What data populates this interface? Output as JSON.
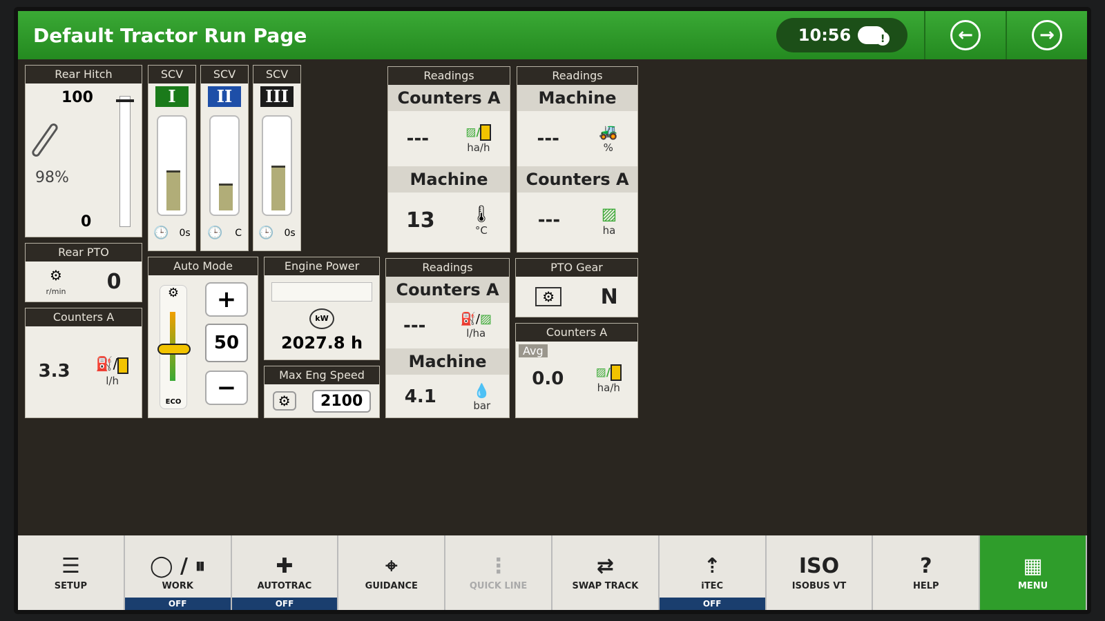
{
  "header": {
    "title": "Default Tractor Run Page",
    "time": "10:56",
    "back_icon": "arrow-left-icon",
    "forward_icon": "arrow-right-icon"
  },
  "rear_hitch": {
    "title": "Rear Hitch",
    "max": "100",
    "min": "0",
    "percent": "98%",
    "level_fraction": 0.98
  },
  "scv": [
    {
      "title": "SCV",
      "numeral": "I",
      "color": "#1a7a1a",
      "timer": "0s",
      "fill_fraction": 0.45
    },
    {
      "title": "SCV",
      "numeral": "II",
      "color": "#1e4fa8",
      "timer": "C",
      "fill_fraction": 0.3
    },
    {
      "title": "SCV",
      "numeral": "III",
      "color": "#1b1b1b",
      "timer": "0s",
      "fill_fraction": 0.5
    }
  ],
  "readings_left": {
    "title": "Readings",
    "a": {
      "name": "Counters A",
      "value": "---",
      "unit": "ha/h"
    },
    "b": {
      "name": "Machine",
      "value": "13",
      "unit": "°C"
    }
  },
  "readings_right": {
    "title": "Readings",
    "a": {
      "name": "Machine",
      "value": "---",
      "unit": "%"
    },
    "b": {
      "name": "Counters A",
      "value": "---",
      "unit": "ha"
    }
  },
  "rear_pto": {
    "title": "Rear PTO",
    "value": "0",
    "unit": "r/min"
  },
  "counters_a_fuel": {
    "title": "Counters A",
    "value": "3.3",
    "unit": "l/h"
  },
  "auto_mode": {
    "title": "Auto Mode",
    "value": "50",
    "plus": "+",
    "minus": "−",
    "eco": "ECO"
  },
  "engine_power": {
    "title": "Engine Power",
    "hours": "2027.8 h",
    "icon_label": "kW"
  },
  "max_eng_speed": {
    "title": "Max Eng Speed",
    "value": "2100"
  },
  "readings_mid": {
    "title": "Readings",
    "a": {
      "name": "Counters A",
      "value": "---",
      "unit": "l/ha"
    },
    "b": {
      "name": "Machine",
      "value": "4.1",
      "unit": "bar"
    }
  },
  "pto_gear": {
    "title": "PTO Gear",
    "value": "N"
  },
  "counters_a_avg": {
    "title": "Counters A",
    "tag": "Avg",
    "value": "0.0",
    "unit": "ha/h"
  },
  "dock": [
    {
      "label": "SETUP",
      "icon": "setup-icon",
      "glyph": "☰",
      "status": ""
    },
    {
      "label": "WORK",
      "icon": "work-icon",
      "glyph": "◯ / ⏸",
      "status": "OFF"
    },
    {
      "label": "AUTOTRAC",
      "icon": "autotrac-icon",
      "glyph": "✚",
      "status": "OFF"
    },
    {
      "label": "GUIDANCE",
      "icon": "guidance-icon",
      "glyph": "⌖",
      "status": ""
    },
    {
      "label": "QUICK LINE",
      "icon": "quick-line-icon",
      "glyph": "⋮",
      "status": ""
    },
    {
      "label": "SWAP TRACK",
      "icon": "swap-track-icon",
      "glyph": "⇄",
      "status": ""
    },
    {
      "label": "iTEC",
      "icon": "itec-icon",
      "glyph": "⇡",
      "status": "OFF"
    },
    {
      "label": "ISOBUS VT",
      "icon": "isobus-icon",
      "glyph": "ISO",
      "status": ""
    },
    {
      "label": "HELP",
      "icon": "help-icon",
      "glyph": "?",
      "status": ""
    },
    {
      "label": "MENU",
      "icon": "menu-icon",
      "glyph": "▦",
      "status": ""
    }
  ]
}
